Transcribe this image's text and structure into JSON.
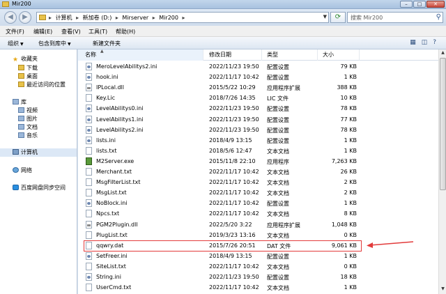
{
  "window": {
    "title": "Mir200"
  },
  "address": {
    "crumbs": [
      "计算机",
      "新加卷 (D:)",
      "Mirserver",
      "Mir200"
    ],
    "search_placeholder": "搜索 Mir200"
  },
  "menu": [
    "文件(F)",
    "编辑(E)",
    "查看(V)",
    "工具(T)",
    "帮助(H)"
  ],
  "toolbar": {
    "organize": "组织",
    "include": "包含到库中",
    "new_folder": "新建文件夹"
  },
  "nav": {
    "favorites": "收藏夹",
    "fav_items": [
      "下载",
      "桌面",
      "最近访问的位置"
    ],
    "libraries": "库",
    "lib_items": [
      "视频",
      "图片",
      "文档",
      "音乐"
    ],
    "computer": "计算机",
    "network": "网络",
    "baidu": "百度网盘同步空间"
  },
  "columns": {
    "name": "名称",
    "date": "修改日期",
    "type": "类型",
    "size": "大小"
  },
  "files": [
    {
      "name": "MeroLevelAbilitys2.ini",
      "date": "2022/11/23 19:50",
      "type": "配置设置",
      "size": "79 KB",
      "kind": "ini"
    },
    {
      "name": "hook.ini",
      "date": "2022/11/17 10:42",
      "type": "配置设置",
      "size": "1 KB",
      "kind": "ini"
    },
    {
      "name": "IPLocal.dll",
      "date": "2015/5/22 10:29",
      "type": "应用程序扩展",
      "size": "388 KB",
      "kind": "dll"
    },
    {
      "name": "Key.Lic",
      "date": "2018/7/26 14:35",
      "type": "LIC 文件",
      "size": "10 KB",
      "kind": "txt"
    },
    {
      "name": "LevelAbilitys0.ini",
      "date": "2022/11/23 19:50",
      "type": "配置设置",
      "size": "78 KB",
      "kind": "ini"
    },
    {
      "name": "LevelAbilitys1.ini",
      "date": "2022/11/23 19:50",
      "type": "配置设置",
      "size": "77 KB",
      "kind": "ini"
    },
    {
      "name": "LevelAbilitys2.ini",
      "date": "2022/11/23 19:50",
      "type": "配置设置",
      "size": "78 KB",
      "kind": "ini"
    },
    {
      "name": "lists.ini",
      "date": "2018/4/9 13:15",
      "type": "配置设置",
      "size": "1 KB",
      "kind": "ini"
    },
    {
      "name": "lists.txt",
      "date": "2018/5/6 12:47",
      "type": "文本文档",
      "size": "1 KB",
      "kind": "txt"
    },
    {
      "name": "M2Server.exe",
      "date": "2015/11/8 22:10",
      "type": "应用程序",
      "size": "7,263 KB",
      "kind": "exe"
    },
    {
      "name": "Merchant.txt",
      "date": "2022/11/17 10:42",
      "type": "文本文档",
      "size": "26 KB",
      "kind": "txt"
    },
    {
      "name": "MsgFilterList.txt",
      "date": "2022/11/17 10:42",
      "type": "文本文档",
      "size": "2 KB",
      "kind": "txt"
    },
    {
      "name": "MsgList.txt",
      "date": "2022/11/17 10:42",
      "type": "文本文档",
      "size": "2 KB",
      "kind": "txt"
    },
    {
      "name": "NoBlock.ini",
      "date": "2022/11/17 10:42",
      "type": "配置设置",
      "size": "1 KB",
      "kind": "ini"
    },
    {
      "name": "Npcs.txt",
      "date": "2022/11/17 10:42",
      "type": "文本文档",
      "size": "8 KB",
      "kind": "txt"
    },
    {
      "name": "PGM2Plugin.dll",
      "date": "2022/5/20 3:22",
      "type": "应用程序扩展",
      "size": "1,048 KB",
      "kind": "dll"
    },
    {
      "name": "PlugList.txt",
      "date": "2019/3/23 13:16",
      "type": "文本文档",
      "size": "0 KB",
      "kind": "txt"
    },
    {
      "name": "qqwry.dat",
      "date": "2015/7/26 20:51",
      "type": "DAT 文件",
      "size": "9,061 KB",
      "kind": "txt"
    },
    {
      "name": "SetFreer.ini",
      "date": "2018/4/9 13:15",
      "type": "配置设置",
      "size": "1 KB",
      "kind": "ini"
    },
    {
      "name": "SiteList.txt",
      "date": "2022/11/17 10:42",
      "type": "文本文档",
      "size": "0 KB",
      "kind": "txt"
    },
    {
      "name": "String.ini",
      "date": "2022/11/23 19:50",
      "type": "配置设置",
      "size": "18 KB",
      "kind": "ini"
    },
    {
      "name": "UserCmd.txt",
      "date": "2022/11/17 10:42",
      "type": "文本文档",
      "size": "1 KB",
      "kind": "txt"
    }
  ]
}
